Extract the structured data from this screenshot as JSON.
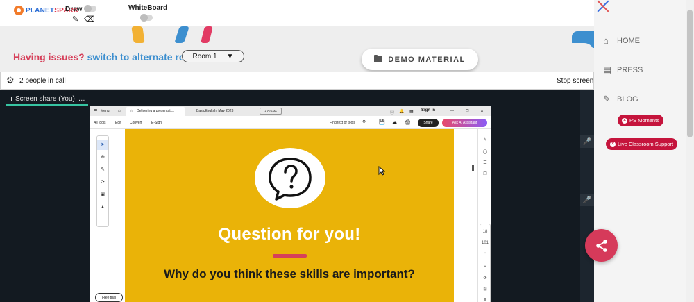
{
  "topbar": {
    "logo_prefix": "PLANET",
    "logo_suffix": "SPARK",
    "draw_label": "Draw",
    "whiteboard_label": "WhiteBoard"
  },
  "issuebar": {
    "issue_text": "Having issues?",
    "switch_text": "switch to alternate room",
    "room_value": "Room 1",
    "demo_material_label": "DEMO MATERIAL"
  },
  "callbar": {
    "people_text": "2 people in call",
    "stop_share_text": "Stop screen"
  },
  "share": {
    "tab_label": "Screen share (You)",
    "tab_more": "…",
    "browser": {
      "menu_label": "Menu",
      "tab1_label": "Delivering a presentati...",
      "tab2_label": "BasicEnglish_May 2023",
      "create_label": "+ Create",
      "sign_in_label": "Sign in",
      "all_tools": "All tools",
      "edit": "Edit",
      "convert": "Convert",
      "esign": "E-Sign",
      "find_text": "Find text or tools",
      "share_label": "Share",
      "ai_label": "Ask AI Assistant",
      "free_trial": "Free trial",
      "page_num": "18",
      "page_total": "101"
    },
    "slide": {
      "title": "Question for you!",
      "question": "Why do you think these skills are important?"
    }
  },
  "rightnav": {
    "items": [
      {
        "label": "HOME",
        "icon": "home-icon"
      },
      {
        "label": "PRESS",
        "icon": "newspaper-icon"
      },
      {
        "label": "BLOG",
        "icon": "pencil-icon"
      }
    ],
    "ps_moments_label": "PS Moments",
    "live_support_label": "Live Classroom Support"
  },
  "colors": {
    "accent_red": "#d6405a",
    "accent_blue": "#3d8fcf",
    "pill_red": "#c5143c",
    "slide_yellow": "#eab308",
    "share_bg": "#131a21"
  }
}
